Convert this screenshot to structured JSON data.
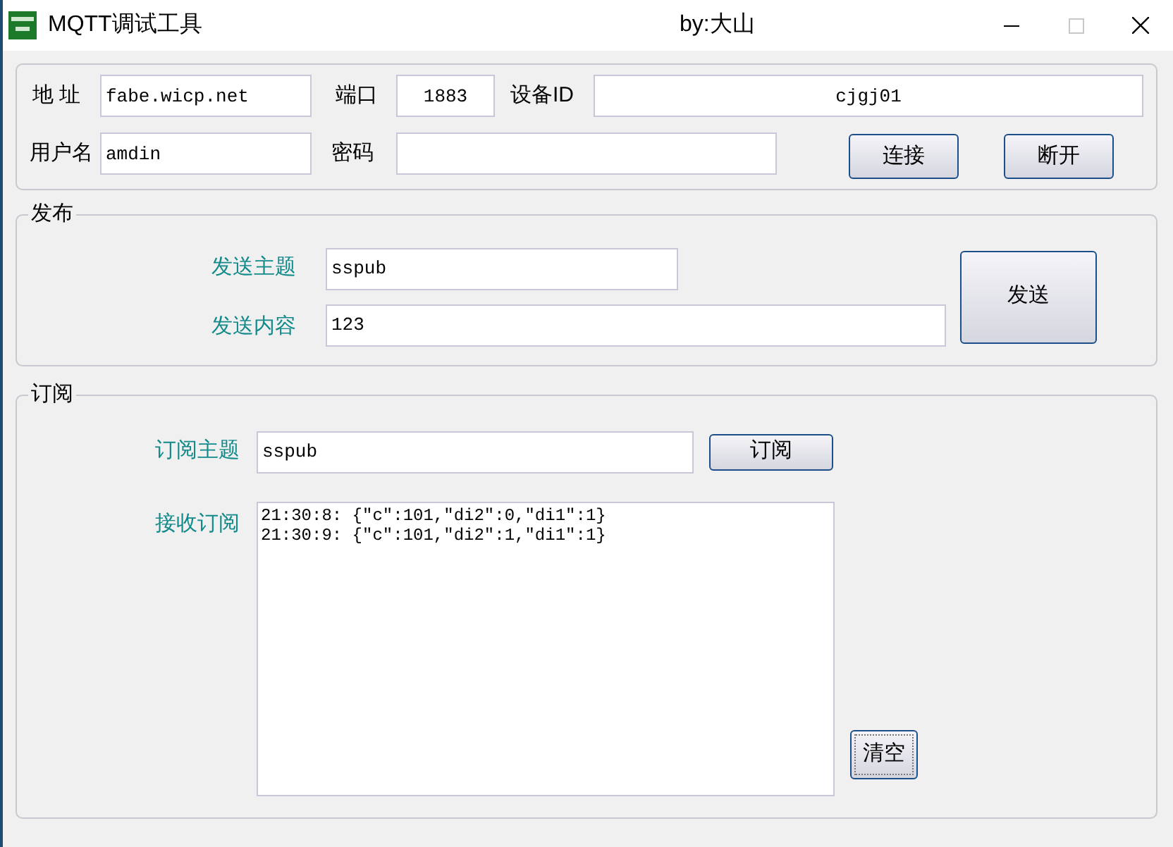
{
  "window": {
    "title": "MQTT调试工具",
    "subtitle": "by:大山"
  },
  "connection": {
    "address_label": "地 址",
    "address": "fabe.wicp.net",
    "port_label": "端口",
    "port": "1883",
    "device_label": "设备ID",
    "device_id": "cjgj01",
    "user_label": "用户名",
    "user": "amdin",
    "password_label": "密码",
    "buttons": [
      "连接",
      "断开"
    ]
  },
  "publish": {
    "title": "发布",
    "topic_label": "发送主题",
    "topic": "sspub",
    "content_label": "发送内容",
    "content": "123",
    "button": "发送"
  },
  "subscribe": {
    "title": "订阅",
    "topic_label": "订阅主题",
    "topic": "sspub",
    "button": "订阅",
    "received_label": "接收订阅",
    "messages": [
      "21:30:8: {\"c\":101,\"di2\":0,\"di1\":1}",
      "21:30:9: {\"c\":101,\"di2\":1,\"di1\":1}"
    ],
    "clear_button": "清空"
  }
}
